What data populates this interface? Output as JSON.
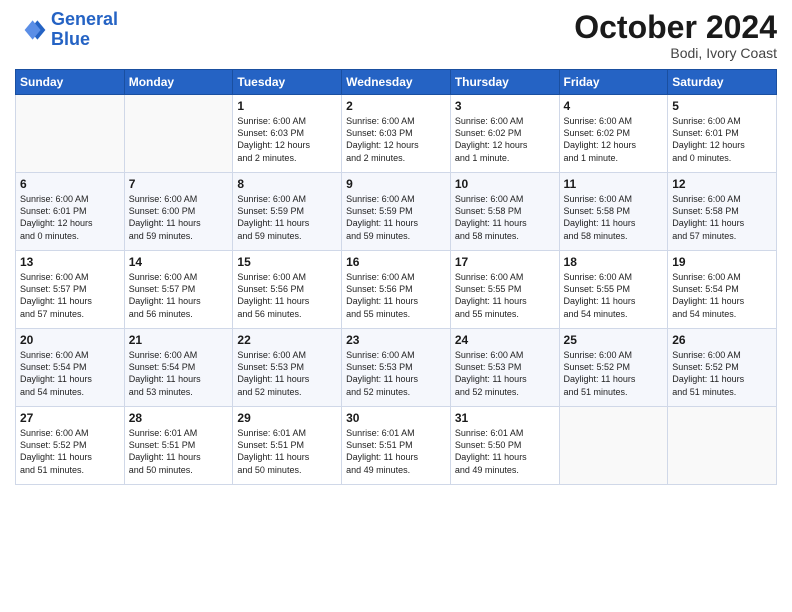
{
  "header": {
    "logo_line1": "General",
    "logo_line2": "Blue",
    "title": "October 2024",
    "subtitle": "Bodi, Ivory Coast"
  },
  "days_of_week": [
    "Sunday",
    "Monday",
    "Tuesday",
    "Wednesday",
    "Thursday",
    "Friday",
    "Saturday"
  ],
  "weeks": [
    [
      {
        "day": "",
        "content": ""
      },
      {
        "day": "",
        "content": ""
      },
      {
        "day": "1",
        "content": "Sunrise: 6:00 AM\nSunset: 6:03 PM\nDaylight: 12 hours\nand 2 minutes."
      },
      {
        "day": "2",
        "content": "Sunrise: 6:00 AM\nSunset: 6:03 PM\nDaylight: 12 hours\nand 2 minutes."
      },
      {
        "day": "3",
        "content": "Sunrise: 6:00 AM\nSunset: 6:02 PM\nDaylight: 12 hours\nand 1 minute."
      },
      {
        "day": "4",
        "content": "Sunrise: 6:00 AM\nSunset: 6:02 PM\nDaylight: 12 hours\nand 1 minute."
      },
      {
        "day": "5",
        "content": "Sunrise: 6:00 AM\nSunset: 6:01 PM\nDaylight: 12 hours\nand 0 minutes."
      }
    ],
    [
      {
        "day": "6",
        "content": "Sunrise: 6:00 AM\nSunset: 6:01 PM\nDaylight: 12 hours\nand 0 minutes."
      },
      {
        "day": "7",
        "content": "Sunrise: 6:00 AM\nSunset: 6:00 PM\nDaylight: 11 hours\nand 59 minutes."
      },
      {
        "day": "8",
        "content": "Sunrise: 6:00 AM\nSunset: 5:59 PM\nDaylight: 11 hours\nand 59 minutes."
      },
      {
        "day": "9",
        "content": "Sunrise: 6:00 AM\nSunset: 5:59 PM\nDaylight: 11 hours\nand 59 minutes."
      },
      {
        "day": "10",
        "content": "Sunrise: 6:00 AM\nSunset: 5:58 PM\nDaylight: 11 hours\nand 58 minutes."
      },
      {
        "day": "11",
        "content": "Sunrise: 6:00 AM\nSunset: 5:58 PM\nDaylight: 11 hours\nand 58 minutes."
      },
      {
        "day": "12",
        "content": "Sunrise: 6:00 AM\nSunset: 5:58 PM\nDaylight: 11 hours\nand 57 minutes."
      }
    ],
    [
      {
        "day": "13",
        "content": "Sunrise: 6:00 AM\nSunset: 5:57 PM\nDaylight: 11 hours\nand 57 minutes."
      },
      {
        "day": "14",
        "content": "Sunrise: 6:00 AM\nSunset: 5:57 PM\nDaylight: 11 hours\nand 56 minutes."
      },
      {
        "day": "15",
        "content": "Sunrise: 6:00 AM\nSunset: 5:56 PM\nDaylight: 11 hours\nand 56 minutes."
      },
      {
        "day": "16",
        "content": "Sunrise: 6:00 AM\nSunset: 5:56 PM\nDaylight: 11 hours\nand 55 minutes."
      },
      {
        "day": "17",
        "content": "Sunrise: 6:00 AM\nSunset: 5:55 PM\nDaylight: 11 hours\nand 55 minutes."
      },
      {
        "day": "18",
        "content": "Sunrise: 6:00 AM\nSunset: 5:55 PM\nDaylight: 11 hours\nand 54 minutes."
      },
      {
        "day": "19",
        "content": "Sunrise: 6:00 AM\nSunset: 5:54 PM\nDaylight: 11 hours\nand 54 minutes."
      }
    ],
    [
      {
        "day": "20",
        "content": "Sunrise: 6:00 AM\nSunset: 5:54 PM\nDaylight: 11 hours\nand 54 minutes."
      },
      {
        "day": "21",
        "content": "Sunrise: 6:00 AM\nSunset: 5:54 PM\nDaylight: 11 hours\nand 53 minutes."
      },
      {
        "day": "22",
        "content": "Sunrise: 6:00 AM\nSunset: 5:53 PM\nDaylight: 11 hours\nand 52 minutes."
      },
      {
        "day": "23",
        "content": "Sunrise: 6:00 AM\nSunset: 5:53 PM\nDaylight: 11 hours\nand 52 minutes."
      },
      {
        "day": "24",
        "content": "Sunrise: 6:00 AM\nSunset: 5:53 PM\nDaylight: 11 hours\nand 52 minutes."
      },
      {
        "day": "25",
        "content": "Sunrise: 6:00 AM\nSunset: 5:52 PM\nDaylight: 11 hours\nand 51 minutes."
      },
      {
        "day": "26",
        "content": "Sunrise: 6:00 AM\nSunset: 5:52 PM\nDaylight: 11 hours\nand 51 minutes."
      }
    ],
    [
      {
        "day": "27",
        "content": "Sunrise: 6:00 AM\nSunset: 5:52 PM\nDaylight: 11 hours\nand 51 minutes."
      },
      {
        "day": "28",
        "content": "Sunrise: 6:01 AM\nSunset: 5:51 PM\nDaylight: 11 hours\nand 50 minutes."
      },
      {
        "day": "29",
        "content": "Sunrise: 6:01 AM\nSunset: 5:51 PM\nDaylight: 11 hours\nand 50 minutes."
      },
      {
        "day": "30",
        "content": "Sunrise: 6:01 AM\nSunset: 5:51 PM\nDaylight: 11 hours\nand 49 minutes."
      },
      {
        "day": "31",
        "content": "Sunrise: 6:01 AM\nSunset: 5:50 PM\nDaylight: 11 hours\nand 49 minutes."
      },
      {
        "day": "",
        "content": ""
      },
      {
        "day": "",
        "content": ""
      }
    ]
  ]
}
